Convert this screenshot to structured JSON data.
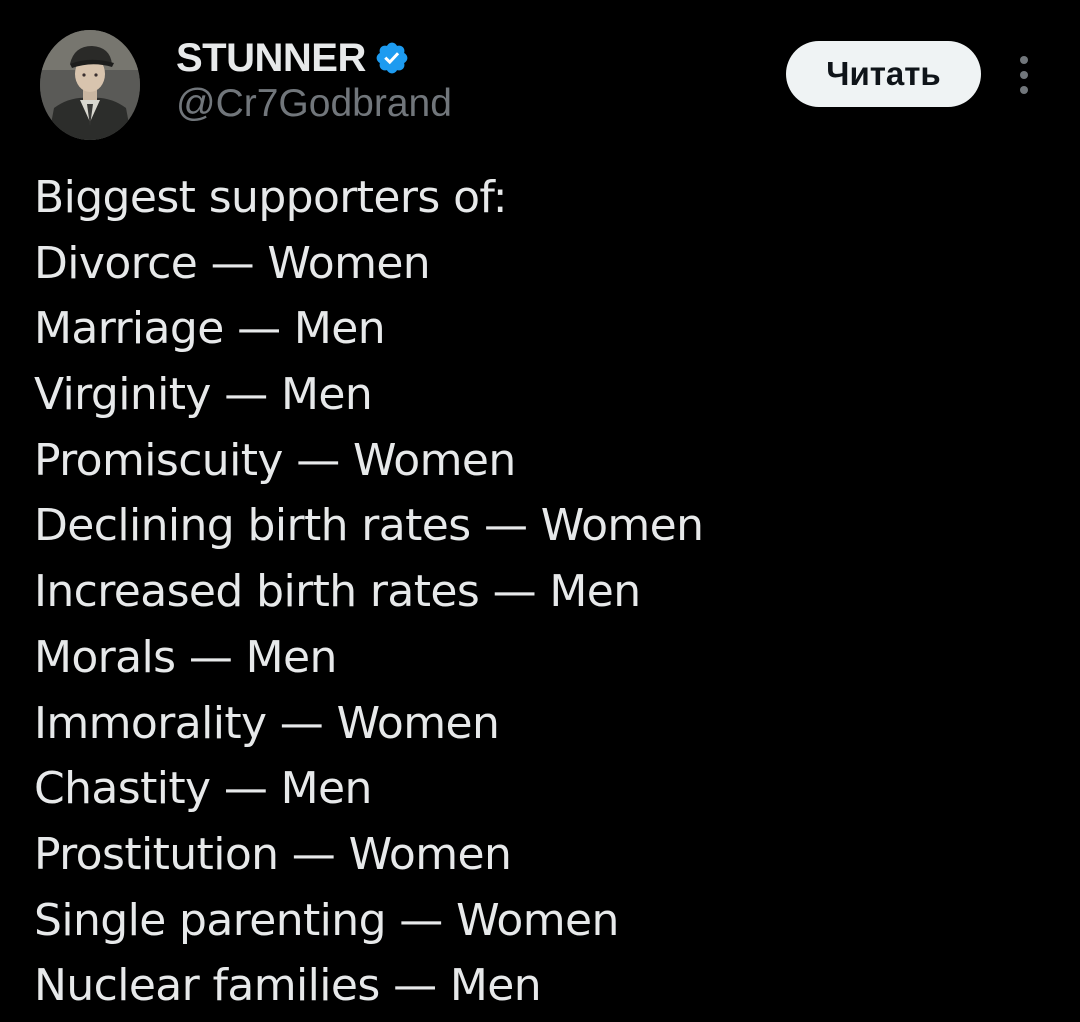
{
  "author": {
    "display_name": "STUNNER",
    "handle": "@Cr7Godbrand",
    "verified": true,
    "avatar_icon": "profile-photo",
    "verified_icon": "verified-badge-icon",
    "verified_color": "#1d9bf0"
  },
  "actions": {
    "follow_label": "Читать",
    "more_icon": "more-vertical-icon"
  },
  "tweet": {
    "lines": [
      "Biggest supporters of:",
      "Divorce — Women",
      "Marriage — Men",
      "Virginity — Men",
      "Promiscuity — Women",
      "Declining birth rates — Women",
      "Increased birth rates — Men",
      "Morals — Men",
      "Immorality — Women",
      "Chastity — Men",
      "Prostitution — Women",
      "Single parenting — Women",
      "Nuclear families — Men"
    ]
  },
  "colors": {
    "background": "#000000",
    "text_primary": "#e7e9ea",
    "text_secondary": "#71767b",
    "button_bg": "#eff3f4",
    "button_text": "#0f1419"
  }
}
